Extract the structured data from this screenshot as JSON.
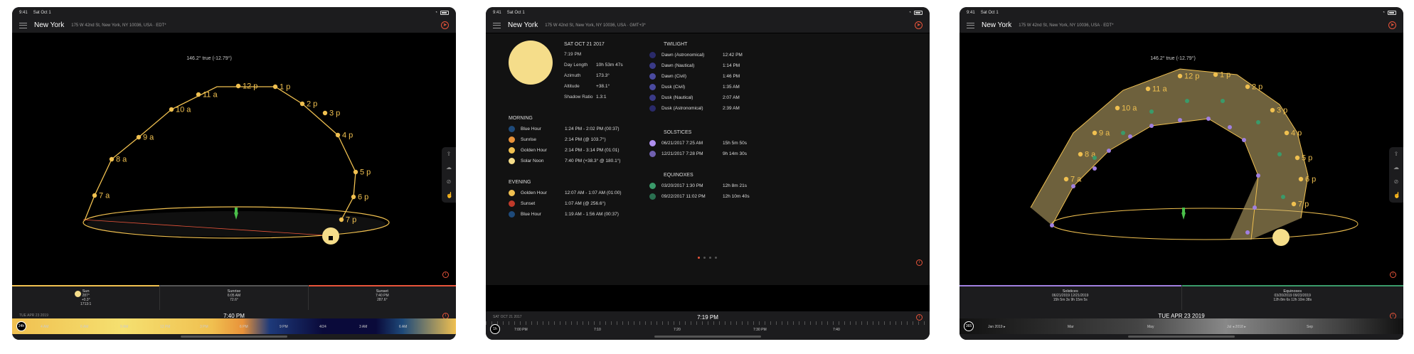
{
  "colors": {
    "accent": "#e8543a",
    "sun": "#f0c050",
    "twilight": "#5a5ab0",
    "equinox": "#3a9a6a",
    "solstice": "#a080e0"
  },
  "status": {
    "time": "9:41",
    "date": "Sat Oct 1"
  },
  "location": {
    "city": "New York",
    "address_edt": "175 W 42nd St, New York, NY 10036, USA · EDT*",
    "address_gmt": "175 W 42nd St, New York, NY 10036, USA · GMT+3*"
  },
  "panel1": {
    "heading": "146.2° true (-12.79°)",
    "hours": [
      "7 a",
      "8 a",
      "9 a",
      "10 a",
      "11 a",
      "12 p",
      "1 p",
      "2 p",
      "3 p",
      "4 p",
      "5 p",
      "6 p",
      "7 p"
    ],
    "summary": [
      {
        "title": "Sun",
        "line1": "287°",
        "line2": "+0.3°",
        "line3": "1713:1"
      },
      {
        "title": "Sunrise",
        "line1": "6:05 AM",
        "line2": "72.6°",
        "line3": ""
      },
      {
        "title": "Sunset",
        "line1": "7:40 PM",
        "line2": "287.6°",
        "line3": ""
      }
    ],
    "date": "TUE APR 23 2019",
    "time": "7:40 PM",
    "dial": "24h",
    "ticks": [
      "4 AM",
      "6 AM",
      "9 AM",
      "12 PM",
      "3 PM",
      "6 PM",
      "9 PM",
      "4/24",
      "3 AM",
      "6 AM"
    ]
  },
  "panel2": {
    "date": "SAT OCT 21 2017",
    "info": [
      {
        "k": "7:19 PM",
        "v": ""
      },
      {
        "k": "Day Length",
        "v": "10h 53m 47s"
      },
      {
        "k": "Azimuth",
        "v": "173.3°"
      },
      {
        "k": "Altitude",
        "v": "+38.1°"
      },
      {
        "k": "Shadow Ratio",
        "v": "1.3:1"
      }
    ],
    "morning_title": "MORNING",
    "morning": [
      {
        "label": "Blue Hour",
        "value": "1:24 PM - 2:02 PM (00:37)",
        "color": "#1e4a7a"
      },
      {
        "label": "Sunrise",
        "value": "2:14 PM (@ 103.7°)",
        "color": "#e8923a"
      },
      {
        "label": "Golden Hour",
        "value": "2:14 PM - 3:14 PM (01:01)",
        "color": "#f0c050"
      },
      {
        "label": "Solar Noon",
        "value": "7:40 PM (+38.3° @ 180.1°)",
        "color": "#f5dd8a"
      }
    ],
    "evening_title": "EVENING",
    "evening": [
      {
        "label": "Golden Hour",
        "value": "12:07 AM - 1:07 AM (01:00)",
        "color": "#f0c050"
      },
      {
        "label": "Sunset",
        "value": "1:07 AM (@ 256.6°)",
        "color": "#c03a2a"
      },
      {
        "label": "Blue Hour",
        "value": "1:19 AM - 1:56 AM (00:37)",
        "color": "#1e4a7a"
      }
    ],
    "twilight_title": "TWILIGHT",
    "twilight": [
      {
        "label": "Dawn (Astronomical)",
        "value": "12:42 PM",
        "color": "#2a2a6a"
      },
      {
        "label": "Dawn (Nautical)",
        "value": "1:14 PM",
        "color": "#3a3a88"
      },
      {
        "label": "Dawn (Civil)",
        "value": "1:46 PM",
        "color": "#4a4aa0"
      },
      {
        "label": "Dusk (Civil)",
        "value": "1:35 AM",
        "color": "#4a4aa0"
      },
      {
        "label": "Dusk (Nautical)",
        "value": "2:07 AM",
        "color": "#3a3a88"
      },
      {
        "label": "Dusk (Astronomical)",
        "value": "2:39 AM",
        "color": "#2a2a6a"
      }
    ],
    "solstices_title": "SOLSTICES",
    "solstices": [
      {
        "label": "06/21/2017  7:25 AM",
        "value": "15h 5m 50s",
        "color": "#b090f0"
      },
      {
        "label": "12/21/2017  7:28 PM",
        "value": "9h 14m 30s",
        "color": "#7060b0"
      }
    ],
    "equinoxes_title": "EQUINOXES",
    "equinoxes": [
      {
        "label": "03/20/2017  1:30 PM",
        "value": "12h 8m 21s",
        "color": "#3a9a6a"
      },
      {
        "label": "09/22/2017  11:02 PM",
        "value": "12h 10m 40s",
        "color": "#2a7050"
      }
    ],
    "tl_date": "SAT OCT 21 2017",
    "time": "7:19 PM",
    "dial": "1h",
    "ticks": [
      "7:00 PM",
      "7:10",
      "7:20",
      "7:30 PM",
      "7:40"
    ]
  },
  "panel3": {
    "heading": "146.2° true (-12.79°)",
    "hours": [
      "7 a",
      "8 a",
      "9 a",
      "10 a",
      "11 a",
      "12 p",
      "1 p",
      "2 p",
      "3 p",
      "4 p",
      "5 p",
      "6 p",
      "7 p"
    ],
    "summary": [
      {
        "title": "Solstices",
        "line1": "06/21/2019   12/21/2019",
        "line2": "15h 5m 3s   9h 15m 5s"
      },
      {
        "title": "Equinoxes",
        "line1": "03/20/2019   09/23/2019",
        "line2": "12h 8m 6s   12h 10m 38s"
      }
    ],
    "date": "TUE APR 23 2019",
    "dial": "365",
    "ticks": [
      "Jan 2019 ▸",
      "Mar",
      "May",
      "Jul ◂ 2018 ▸",
      "Sep"
    ]
  }
}
